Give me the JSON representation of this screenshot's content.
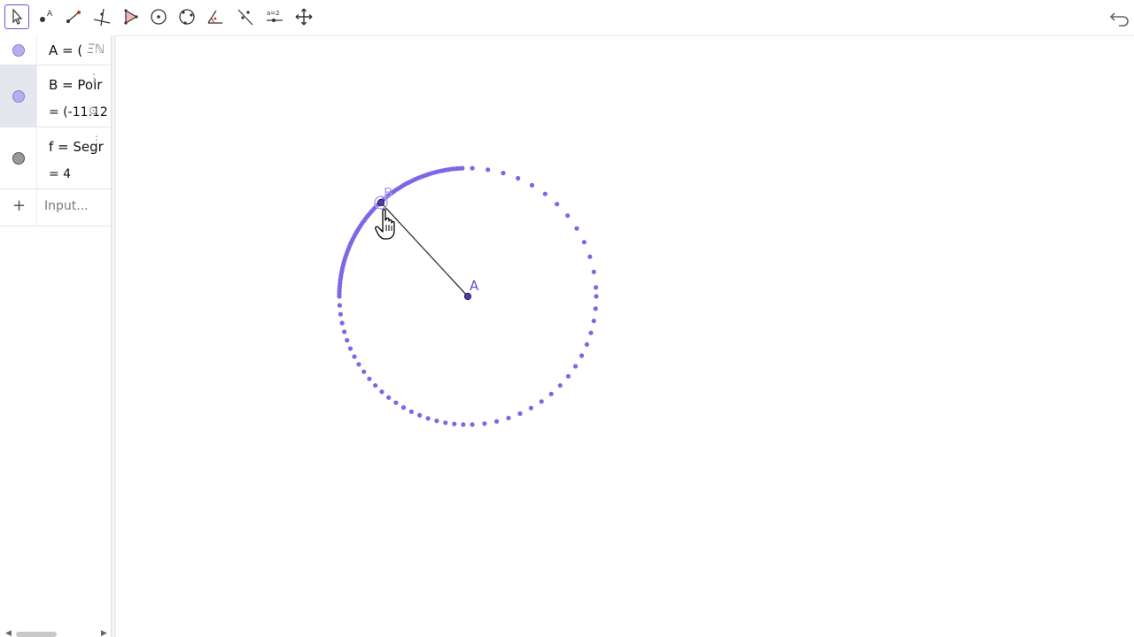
{
  "toolbar": {
    "tools": [
      "move-tool",
      "point-tool",
      "segment-tool",
      "perpendicular-line-tool",
      "polygon-tool",
      "circle-center-point-tool",
      "circle-three-points-tool",
      "angle-tool",
      "reflect-tool",
      "slider-tool",
      "move-graphics-view-tool"
    ],
    "selected": "move-tool",
    "slider_icon_text": "a=2"
  },
  "algebra": {
    "rows": [
      {
        "name": "A",
        "text": "A = (",
        "icon": "Ξℕ",
        "marble_color": "#b7aef0"
      },
      {
        "name": "B",
        "text": "B = Poir",
        "value": "= (-11.12",
        "marble_color": "#b7aef0"
      },
      {
        "name": "f",
        "text": "f = Segr",
        "value": "= 4",
        "marble_color": "#9a9a9a"
      }
    ],
    "input_plus": "+",
    "input_placeholder": "Input..."
  },
  "graphics": {
    "label_A": "A",
    "label_B": "B",
    "accent": "#7b68e8",
    "segment_color": "#333333"
  }
}
